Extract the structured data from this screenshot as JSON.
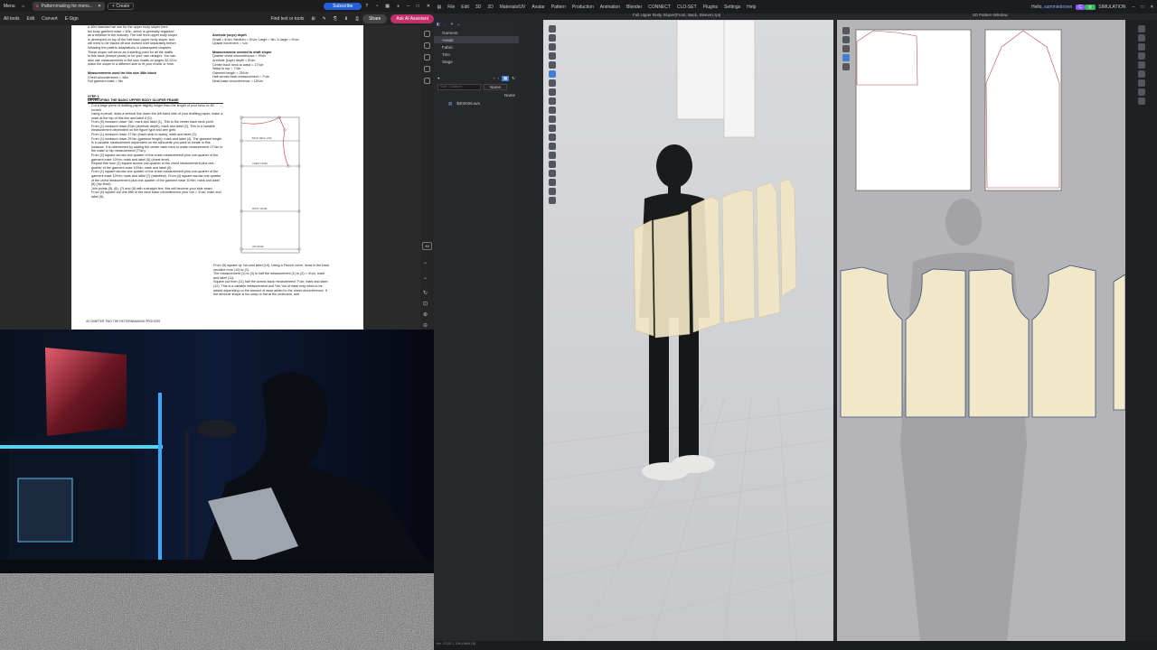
{
  "pdf": {
    "tabbar": {
      "menu_label": "Menu",
      "tab_title": "Patternmaking for mens...",
      "create_label": "+ Create",
      "subscribe_label": "Subscribe"
    },
    "menubar": {
      "items": [
        "All tools",
        "Edit",
        "Convert",
        "E-Sign"
      ],
      "find_tools_label": "Find text or tools",
      "share_label": "Share",
      "ai_label": "Ask AI Assistant"
    },
    "page": {
      "top_left_lines": [
        "a 40in standard we use for the upper body sloper here.",
        "full body garment ease = 40in, which is generally regarded",
        "as a medium in the industry. The half front upper body sloper",
        "is developed on top of the half back upper body sloper and",
        "will need to be traced off and worked over separately before",
        "following the pattern adaptations in subsequent chapters.",
        "These sloper will serve as a starting point for all the drafts",
        "in this back (except pants) or for your own designs. You can",
        "also use measurements in the size charts on pages 32-33 to",
        "make the sloper in a different size to fit your model or form."
      ],
      "measurements_heading": "Measurements used for this size 38in block",
      "measurements_lines": [
        "Chest circumference = 38in",
        "Full garment ease = 5in"
      ],
      "step_label": "STEP 1",
      "step_title": "DEVELOPING THE BASIC UPPER BODY SLOPER FRAME",
      "steps": [
        "Cut a large piece of drafting paper slightly longer than the length of your torso or 80 inches.",
        "Using a pencil, draw a vertical line down the left-hand side of your drafting paper; make a mark at the top of this line and label it (0).",
        "From (0) measure down ¾in, mark and label (1). This is the center back neck point.",
        "From (1) measure down 8¾in (armhole depth); mark and label (2). This is a variable measurement dependent on the figure type and arm girth.",
        "From (1) measure down 17¾in (back neck to waist); mark and label (3).",
        "From (1) measure down 25¾in (garment length); mark and label (4). The garment length is a variable measurement dependent on the silhouette you want to create in this instance. It is determined by adding the center back neck to waist measurement 17¾in to the waist to hip measurement (7¾in).",
        "From (2) square across one-quarter of the chest measurement plus one-quarter of the garment ease 10½in; mark and label (5) (chest level).",
        "Repeat this from (3) square across one-quarter of the chest measurement plus one-quarter of the garment ease 10½in; mark and label (6).",
        "From (1) square across one-quarter of the chest measurement plus one-quarter of the garment ease 10½in; mark and label (7) (waistline). From (4) square across one-quarter of the chest measurement plus one-quarter of the garment ease 10½in; mark and label (8) (hip level).",
        "Join points (5), (6), (7) and (8) with a straight line; this will become your side seam.",
        "From (0) square out one-fifth of the neck base circumference plus ¼in = 3¼in; mark and label (9)."
      ],
      "armhole_heading": "Armhole (scye) depth",
      "armhole_lines": [
        "Small = 8¼in; Medium = 8¾in; Large = 9in; X-large = 9¼in",
        "Upside increment = ¼in"
      ],
      "needed_heading": "Measurements needed to draft sloper",
      "needed_lines": [
        "Quarter chest circumference = 9½in",
        "Armhole (scye) depth = 8¾in",
        "Center back neck to waist = 17¾in",
        "Waist to hip = 7¾in",
        "Garment length = 25¾in",
        "Half across back measurement = 7¼in",
        "Neck base circumference = 15¾in"
      ],
      "right_steps": [
        "From (9) square up ¾in and label (10). Using a French curve, draw in the back neckline from (10) to (1).",
        "The measurement (1) to (3) is half the measurement (1) to (2) = 4¼in; mark and label (11).",
        "Square out from (11) half the across back measurement 7¼in; mark and label (12). This is a variable measurement and ½in-¾in of ease may need to be added depending on the amount of ease added to the chest circumference. If the armhole shape is too deep or flat at the underarm, add"
      ],
      "footer": "40 CHAPTER TWO THE PATTERNMAKING PROCESS",
      "diagram_labels": [
        "BACK NECK LINE",
        "CHEST LEVEL",
        "WAIST LEVEL",
        "HIP LEVEL"
      ]
    },
    "sidebar_icons": [
      "comment-icon",
      "bookmark-icon",
      "search-icon",
      "page-icon",
      "attachment-icon"
    ],
    "zoom_label": "48"
  },
  "clo": {
    "menu": {
      "items": [
        "File",
        "Edit",
        "3D",
        "2D",
        "Materials/UV",
        "Avatar",
        "Pattern",
        "Production",
        "Animation",
        "Blender",
        "CONNECT",
        "CLO-SET",
        "Plugins",
        "Settings",
        "Help"
      ],
      "greeting": "Hello, ",
      "username": "sammiebrown",
      "mode_label": "SIMULATION"
    },
    "title_3d": "Full Upper Body Sloper(Front, Back, Sleeve).zprj",
    "title_2d": "2D Pattern Window",
    "explorer": {
      "tabs": [
        "Garment",
        "Avatar",
        "Fabric",
        "Trim",
        "Stage"
      ],
      "selected_tab": "Avatar",
      "search_placeholder": "Size : Custom",
      "sort_label": "Name",
      "column_header": "Name",
      "file_item": "$202026.avs"
    },
    "statusbar": "Ver. 2025.1.106 (r86415)"
  }
}
